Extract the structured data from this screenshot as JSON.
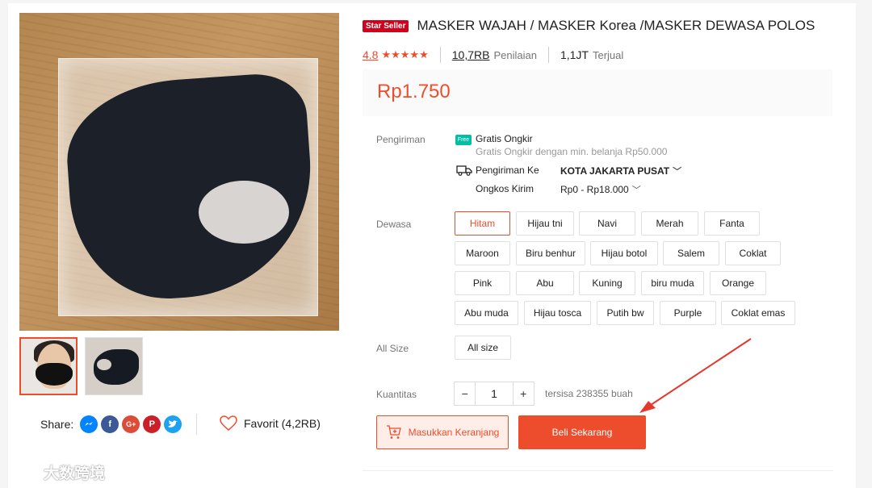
{
  "product": {
    "badge": "Star Seller",
    "title": "MASKER WAJAH / MASKER Korea /MASKER DEWASA POLOS",
    "rating": "4.8",
    "stars": "★★★★★",
    "reviews_count": "10,7RB",
    "reviews_label": "Penilaian",
    "sold_count": "1,1JT",
    "sold_label": "Terjual",
    "price": "Rp1.750"
  },
  "shipping": {
    "label": "Pengiriman",
    "free_icon_text": "Free",
    "free_title": "Gratis Ongkir",
    "free_sub": "Gratis Ongkir dengan min. belanja Rp50.000",
    "to_label": "Pengiriman Ke",
    "to_value": "KOTA JAKARTA PUSAT",
    "cost_label": "Ongkos Kirim",
    "cost_value": "Rp0 - Rp18.000"
  },
  "variants": {
    "label": "Dewasa",
    "selected": "Hitam",
    "options": [
      "Hitam",
      "Hijau tni",
      "Navi",
      "Merah",
      "Fanta",
      "Maroon",
      "Biru benhur",
      "Hijau botol",
      "Salem",
      "Coklat",
      "Pink",
      "Abu",
      "Kuning",
      "biru muda",
      "Orange",
      "Abu muda",
      "Hijau tosca",
      "Putih bw",
      "Purple",
      "Coklat emas"
    ]
  },
  "size": {
    "label": "All Size",
    "option": "All size"
  },
  "quantity": {
    "label": "Kuantitas",
    "minus": "−",
    "value": "1",
    "plus": "+",
    "stock": "tersisa 238355 buah"
  },
  "actions": {
    "cart": "Masukkan Keranjang",
    "buy": "Beli Sekarang"
  },
  "share": {
    "label": "Share:",
    "icons": [
      "messenger-icon",
      "facebook-icon",
      "google-plus-icon",
      "pinterest-icon",
      "twitter-icon"
    ],
    "facebook_glyph": "f",
    "google_glyph": "G+",
    "pinterest_glyph": "P"
  },
  "favorite": {
    "label": "Favorit (4,2RB)"
  },
  "watermark": {
    "text": "大数跨境"
  },
  "colors": {
    "accent": "#ee4d2d",
    "star_seller": "#d0011b",
    "free_ship": "#00bfa5",
    "messenger": "#0084ff",
    "facebook": "#3b5998",
    "google": "#dd4b39",
    "pinterest": "#cb2027",
    "twitter": "#1da1f2"
  }
}
